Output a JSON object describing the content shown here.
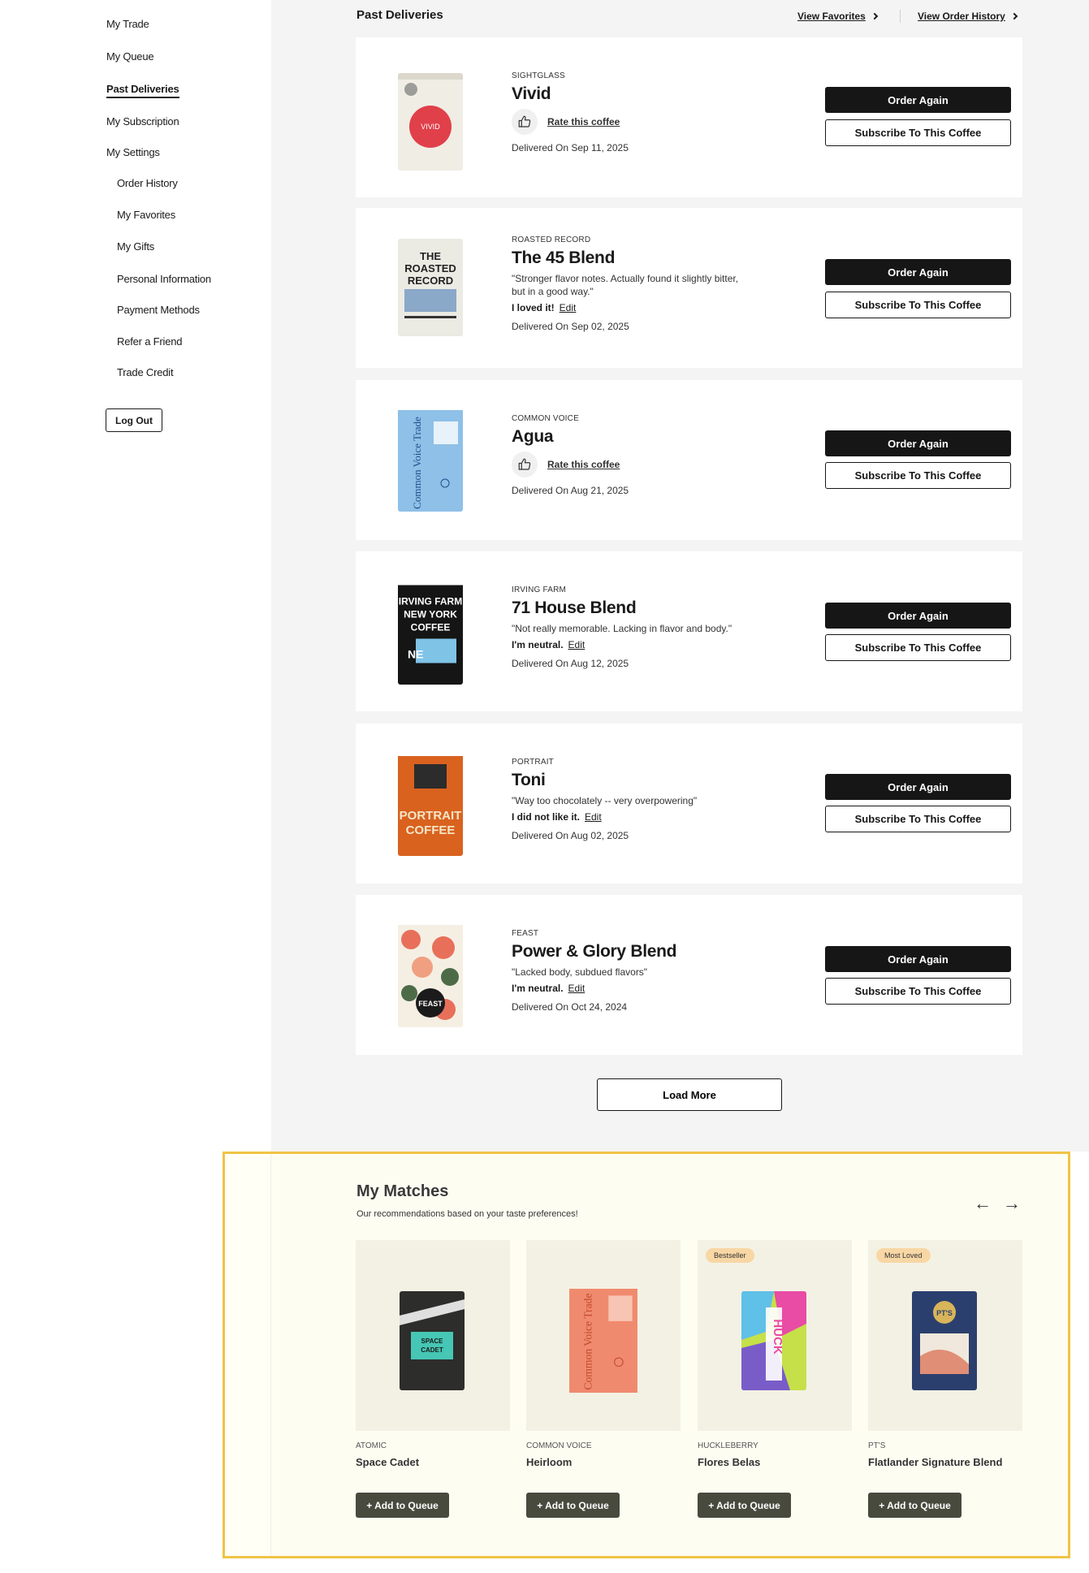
{
  "sidebar": {
    "items": [
      {
        "label": "My Trade"
      },
      {
        "label": "My Queue"
      },
      {
        "label": "Past Deliveries"
      },
      {
        "label": "My Subscription"
      },
      {
        "label": "My Settings"
      },
      {
        "label": "Order History"
      },
      {
        "label": "My Favorites"
      },
      {
        "label": "My Gifts"
      },
      {
        "label": "Personal Information"
      },
      {
        "label": "Payment Methods"
      },
      {
        "label": "Refer a Friend"
      },
      {
        "label": "Trade Credit"
      }
    ],
    "active": "Past Deliveries",
    "logout_label": "Log Out"
  },
  "header": {
    "title": "Past Deliveries",
    "view_favorites": "View Favorites",
    "view_order_history": "View Order History"
  },
  "deliveries": [
    {
      "roaster": "SIGHTGLASS",
      "name": "Vivid",
      "rate_label": "Rate this coffee",
      "delivered": "Delivered On Sep 11, 2025",
      "order_label": "Order Again",
      "subscribe_label": "Subscribe To This Coffee",
      "bag_text": "VIVID",
      "bag_color": "#f0ede4",
      "accent_color": "#e0404a"
    },
    {
      "roaster": "ROASTED RECORD",
      "name": "The 45 Blend",
      "review": "\"Stronger flavor notes. Actually found it slightly bitter, but in a good way.\"",
      "verdict": "I loved it!",
      "edit_label": "Edit",
      "delivered": "Delivered On Sep 02, 2025",
      "order_label": "Order Again",
      "subscribe_label": "Subscribe To This Coffee",
      "bag_text": "THE ROASTED RECORD",
      "bag_color": "#ebeae3",
      "accent_color": "#8aa8c8"
    },
    {
      "roaster": "COMMON VOICE",
      "name": "Agua",
      "rate_label": "Rate this coffee",
      "delivered": "Delivered On Aug 21, 2025",
      "order_label": "Order Again",
      "subscribe_label": "Subscribe To This Coffee",
      "bag_text": "Common Voice Trade",
      "bag_color": "#8ec0e8",
      "accent_color": "#3b6fae"
    },
    {
      "roaster": "IRVING FARM",
      "name": "71 House Blend",
      "review": "\"Not really memorable. Lacking in flavor and body.\"",
      "verdict": "I'm neutral.",
      "edit_label": "Edit",
      "delivered": "Delivered On Aug 12, 2025",
      "order_label": "Order Again",
      "subscribe_label": "Subscribe To This Coffee",
      "bag_text": "IRVING FARM NEW YORK COFFEE",
      "bag_color": "#151515",
      "accent_color": "#7fc3e6"
    },
    {
      "roaster": "PORTRAIT",
      "name": "Toni",
      "review": "\"Way too chocolately -- very overpowering\"",
      "verdict": "I did not like it.",
      "edit_label": "Edit",
      "delivered": "Delivered On Aug 02, 2025",
      "order_label": "Order Again",
      "subscribe_label": "Subscribe To This Coffee",
      "bag_text": "PORTRAIT COFFEE",
      "bag_color": "#d9621f",
      "accent_color": "#2c2c2c"
    },
    {
      "roaster": "FEAST",
      "name": "Power & Glory Blend",
      "review": "\"Lacked body, subdued flavors\"",
      "verdict": "I'm neutral.",
      "edit_label": "Edit",
      "delivered": "Delivered On Oct 24, 2024",
      "order_label": "Order Again",
      "subscribe_label": "Subscribe To This Coffee",
      "bag_text": "FEAST",
      "bag_color": "#f5efe3",
      "accent_color": "#e8705a"
    }
  ],
  "load_more_label": "Load More",
  "matches": {
    "title": "My Matches",
    "subtitle": "Our recommendations based on your taste preferences!",
    "prev_icon": "arrow-left-icon",
    "next_icon": "arrow-right-icon",
    "items": [
      {
        "roaster": "ATOMIC",
        "name": "Space Cadet",
        "badge": "",
        "add_label": "+ Add to Queue",
        "bag_text": "SPACE CADET",
        "bag_color": "#2d2d2b",
        "accent_color": "#46c6b4"
      },
      {
        "roaster": "COMMON VOICE",
        "name": "Heirloom",
        "badge": "",
        "add_label": "+ Add to Queue",
        "bag_text": "Common Voice Trade",
        "bag_color": "#f08a6e",
        "accent_color": "#c0492c"
      },
      {
        "roaster": "HUCKLEBERRY",
        "name": "Flores Belas",
        "badge": "Bestseller",
        "add_label": "+ Add to Queue",
        "bag_text": "HUCK",
        "bag_color": "#c6e04a",
        "accent_color": "#e84ca4"
      },
      {
        "roaster": "PT'S",
        "name": "Flatlander Signature Blend",
        "badge": "Most Loved",
        "add_label": "+ Add to Queue",
        "bag_text": "PT'S",
        "bag_color": "#2b3f6e",
        "accent_color": "#f0e8dc"
      }
    ]
  }
}
